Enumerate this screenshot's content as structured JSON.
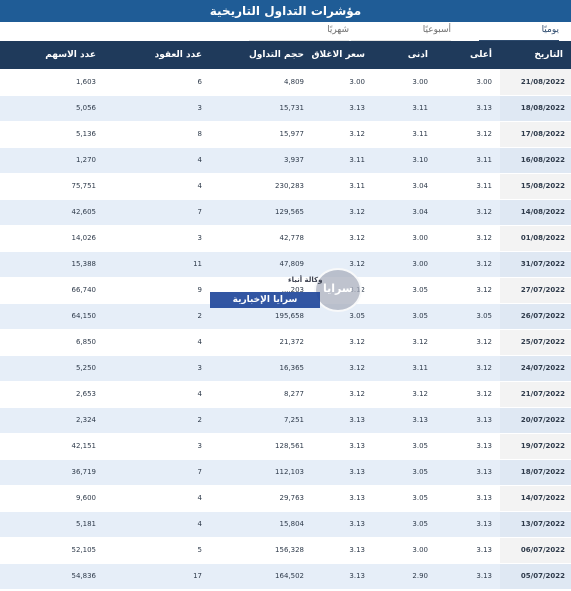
{
  "title": "مؤشرات التداول التاريخية",
  "tabs": {
    "daily": "يوميًا",
    "weekly": "أسبوعيًا",
    "monthly": "شهريًا"
  },
  "columns": {
    "date": "التاريخ",
    "high": "أعلى",
    "low": "ادنى",
    "close": "سعر الاغلاق",
    "volume": "حجم التداول",
    "contracts": "عدد العقود",
    "shares": "عدد الاسهم"
  },
  "rows": [
    {
      "date": "21/08/2022",
      "high": "3.00",
      "low": "3.00",
      "close": "3.00",
      "volume": "4,809",
      "contracts": "6",
      "shares": "1,603"
    },
    {
      "date": "18/08/2022",
      "high": "3.13",
      "low": "3.11",
      "close": "3.13",
      "volume": "15,731",
      "contracts": "3",
      "shares": "5,056"
    },
    {
      "date": "17/08/2022",
      "high": "3.12",
      "low": "3.11",
      "close": "3.12",
      "volume": "15,977",
      "contracts": "8",
      "shares": "5,136"
    },
    {
      "date": "16/08/2022",
      "high": "3.11",
      "low": "3.10",
      "close": "3.11",
      "volume": "3,937",
      "contracts": "4",
      "shares": "1,270"
    },
    {
      "date": "15/08/2022",
      "high": "3.11",
      "low": "3.04",
      "close": "3.11",
      "volume": "230,283",
      "contracts": "4",
      "shares": "75,751"
    },
    {
      "date": "14/08/2022",
      "high": "3.12",
      "low": "3.04",
      "close": "3.12",
      "volume": "129,565",
      "contracts": "7",
      "shares": "42,605"
    },
    {
      "date": "01/08/2022",
      "high": "3.12",
      "low": "3.00",
      "close": "3.12",
      "volume": "42,778",
      "contracts": "3",
      "shares": "14,026"
    },
    {
      "date": "31/07/2022",
      "high": "3.12",
      "low": "3.00",
      "close": "3.12",
      "volume": "47,809",
      "contracts": "11",
      "shares": "15,388"
    },
    {
      "date": "27/07/2022",
      "high": "3.12",
      "low": "3.05",
      "close": "3.12",
      "volume": "203,...",
      "contracts": "9",
      "shares": "66,740"
    },
    {
      "date": "26/07/2022",
      "high": "3.05",
      "low": "3.05",
      "close": "3.05",
      "volume": "195,658",
      "contracts": "2",
      "shares": "64,150"
    },
    {
      "date": "25/07/2022",
      "high": "3.12",
      "low": "3.12",
      "close": "3.12",
      "volume": "21,372",
      "contracts": "4",
      "shares": "6,850"
    },
    {
      "date": "24/07/2022",
      "high": "3.12",
      "low": "3.11",
      "close": "3.12",
      "volume": "16,365",
      "contracts": "3",
      "shares": "5,250"
    },
    {
      "date": "21/07/2022",
      "high": "3.12",
      "low": "3.12",
      "close": "3.12",
      "volume": "8,277",
      "contracts": "4",
      "shares": "2,653"
    },
    {
      "date": "20/07/2022",
      "high": "3.13",
      "low": "3.13",
      "close": "3.13",
      "volume": "7,251",
      "contracts": "2",
      "shares": "2,324"
    },
    {
      "date": "19/07/2022",
      "high": "3.13",
      "low": "3.05",
      "close": "3.13",
      "volume": "128,561",
      "contracts": "3",
      "shares": "42,151"
    },
    {
      "date": "18/07/2022",
      "high": "3.13",
      "low": "3.05",
      "close": "3.13",
      "volume": "112,103",
      "contracts": "7",
      "shares": "36,719"
    },
    {
      "date": "14/07/2022",
      "high": "3.13",
      "low": "3.05",
      "close": "3.13",
      "volume": "29,763",
      "contracts": "4",
      "shares": "9,600"
    },
    {
      "date": "13/07/2022",
      "high": "3.13",
      "low": "3.05",
      "close": "3.13",
      "volume": "15,804",
      "contracts": "4",
      "shares": "5,181"
    },
    {
      "date": "06/07/2022",
      "high": "3.13",
      "low": "3.00",
      "close": "3.13",
      "volume": "156,328",
      "contracts": "5",
      "shares": "52,105"
    },
    {
      "date": "05/07/2022",
      "high": "3.13",
      "low": "2.90",
      "close": "3.13",
      "volume": "164,502",
      "contracts": "17",
      "shares": "54,836"
    }
  ],
  "watermark": {
    "top_text": "وكالة أنباء",
    "brand": "سرايا",
    "band_text": "سرايا الإخبارية"
  },
  "colors": {
    "title_bar": "#1f5c96",
    "header": "#1f3a5b",
    "row_alt": "#e6eef8"
  }
}
